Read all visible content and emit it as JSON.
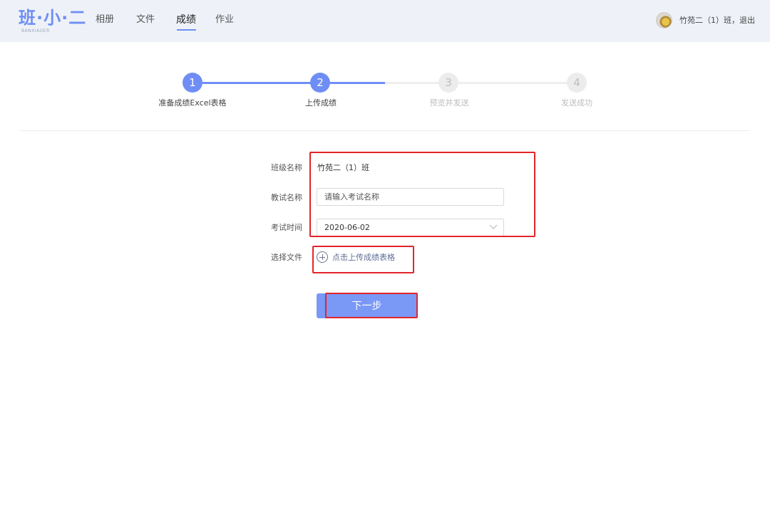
{
  "header": {
    "logo_text": "班·小·二",
    "logo_sub": "BANXIAOER",
    "nav": [
      "相册",
      "文件",
      "成绩",
      "作业"
    ],
    "active_nav": "成绩",
    "user_text": "竹苑二（1）班，退出"
  },
  "steps": [
    {
      "num": "1",
      "label": "准备成绩Excel表格",
      "state": "done"
    },
    {
      "num": "2",
      "label": "上传成绩",
      "state": "done"
    },
    {
      "num": "3",
      "label": "预览并发送",
      "state": "todo"
    },
    {
      "num": "4",
      "label": "发送成功",
      "state": "todo"
    }
  ],
  "form": {
    "class_label": "班级名称",
    "class_value": "竹苑二（1）班",
    "exam_label": "教试名称",
    "exam_placeholder": "请输入考试名称",
    "time_label": "考试时间",
    "time_value": "2020-06-02",
    "file_label": "选择文件",
    "upload_text": "点击上传成绩表格"
  },
  "next_button": "下一步",
  "colors": {
    "accent": "#6f8ef5",
    "header_bg": "#eef2f8",
    "annotation": "#e2252c"
  }
}
